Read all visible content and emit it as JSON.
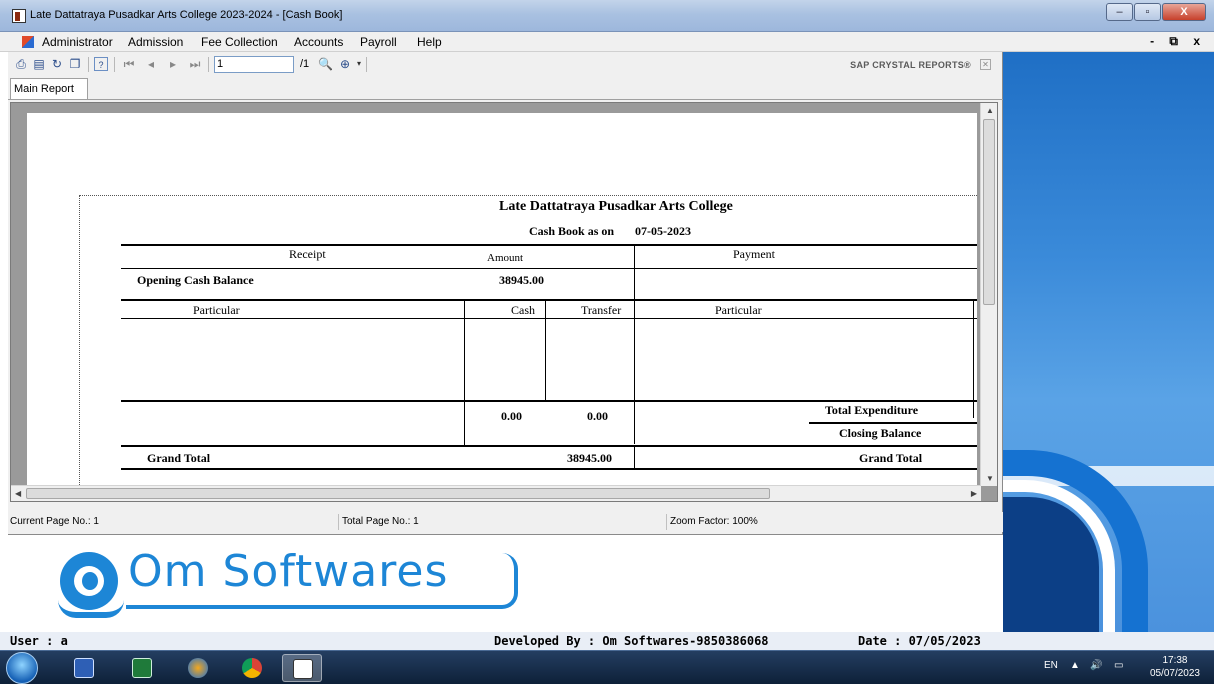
{
  "window": {
    "title": "Late Dattatraya Pusadkar Arts College 2023-2024 - [Cash Book]",
    "minimize": "–",
    "restore": "▫",
    "close": "X"
  },
  "menu": {
    "items": [
      "Administrator",
      "Admission",
      "Fee Collection",
      "Accounts",
      "Payroll",
      "Help"
    ],
    "mdi_controls": "- ⧉ x"
  },
  "report_toolbar": {
    "page_value": "1",
    "page_total": "/1",
    "brand": "SAP CRYSTAL REPORTS®"
  },
  "tab": {
    "label": "Main Report"
  },
  "report": {
    "college": "Late Dattatraya Pusadkar Arts College",
    "cash_book_label": "Cash Book as on",
    "date": "07-05-2023",
    "receipt": "Receipt",
    "amount": "Amount",
    "payment": "Payment",
    "opening_label": "Opening Cash Balance",
    "opening_value": "38945.00",
    "particular_left": "Particular",
    "cash": "Cash",
    "transfer": "Transfer",
    "particular_right": "Particular",
    "cash_total": "0.00",
    "transfer_total": "0.00",
    "total_expenditure": "Total Expenditure",
    "closing_balance": "Closing Balance",
    "grand_total_left": "Grand Total",
    "grand_total_value": "38945.00",
    "grand_total_right": "Grand Total"
  },
  "status": {
    "current_page": "Current Page No.: 1",
    "total_page": "Total Page No.: 1",
    "zoom": "Zoom Factor: 100%"
  },
  "logo": {
    "text": "Om Softwares"
  },
  "app_status": {
    "user": "User : a",
    "developer": "Developed By : Om Softwares-9850386068",
    "date": "Date : 07/05/2023"
  },
  "taskbar": {
    "lang": "EN",
    "time": "17:38",
    "date": "05/07/2023"
  }
}
